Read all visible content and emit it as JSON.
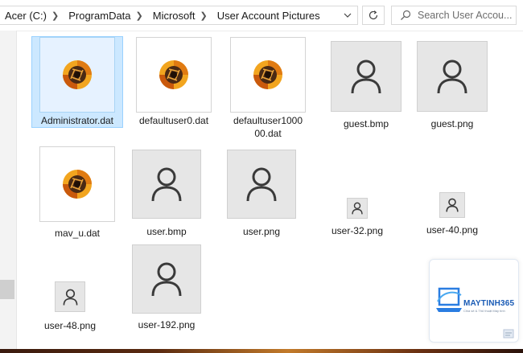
{
  "address_bar": {
    "breadcrumbs": [
      "Acer (C:)",
      "ProgramData",
      "Microsoft",
      "User Account Pictures"
    ],
    "search_placeholder": "Search User Accou..."
  },
  "icons": {
    "file_thumb": "aperture-logo-icon",
    "user_thumb": "user-silhouette-icon",
    "refresh": "refresh-icon",
    "search": "search-icon",
    "dropdown": "chevron-down-icon"
  },
  "files": [
    {
      "name": "Administrator.dat",
      "kind": "dat",
      "selected": true
    },
    {
      "name": "defaultuser0.dat",
      "kind": "dat"
    },
    {
      "name": "defaultuser100000.dat",
      "kind": "dat"
    },
    {
      "name": "guest.bmp",
      "kind": "user"
    },
    {
      "name": "guest.png",
      "kind": "user"
    },
    {
      "name": "mav_u.dat",
      "kind": "dat"
    },
    {
      "name": "user.bmp",
      "kind": "user"
    },
    {
      "name": "user.png",
      "kind": "user"
    },
    {
      "name": "user-32.png",
      "kind": "user"
    },
    {
      "name": "user-40.png",
      "kind": "user"
    },
    {
      "name": "user-48.png",
      "kind": "user"
    },
    {
      "name": "user-192.png",
      "kind": "user"
    }
  ],
  "watermark": {
    "brand": "MAYTINH365",
    "tagline": "Chia sẻ & Thủ thuật Máy tính"
  },
  "colors": {
    "selection_bg": "#cce8ff",
    "selection_border": "#99d1ff",
    "thumb_gray": "#e6e6e6",
    "user_icon": "#3a3a3a",
    "brand_blue": "#1a5bb5"
  }
}
